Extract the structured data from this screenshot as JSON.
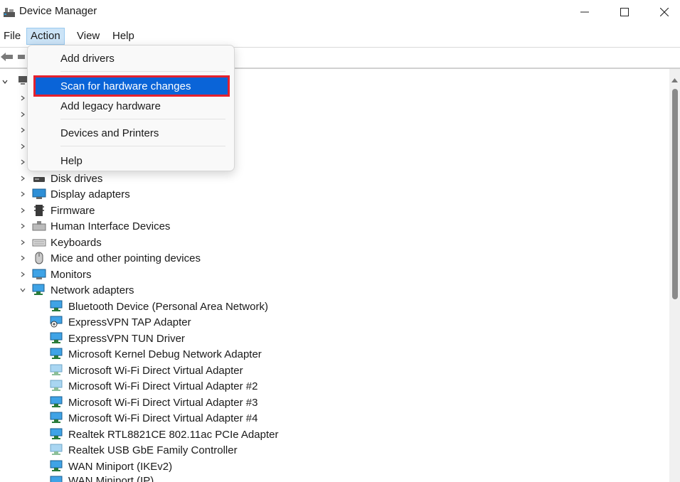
{
  "window": {
    "title": "Device Manager",
    "controls": {
      "minimize": "minimize",
      "maximize": "maximize",
      "close": "close"
    }
  },
  "menubar": {
    "items": [
      {
        "label": "File"
      },
      {
        "label": "Action",
        "active": true
      },
      {
        "label": "View"
      },
      {
        "label": "Help"
      }
    ]
  },
  "action_menu": {
    "items": [
      {
        "label": "Add drivers"
      },
      {
        "label": "Scan for hardware changes",
        "highlighted": true
      },
      {
        "label": "Add legacy hardware"
      },
      {
        "label": "Devices and Printers"
      },
      {
        "label": "Help"
      }
    ]
  },
  "tree": {
    "categories": [
      {
        "label": "Disk drives",
        "icon": "disk-drive-icon",
        "expanded": false
      },
      {
        "label": "Display adapters",
        "icon": "display-adapter-icon",
        "expanded": false
      },
      {
        "label": "Firmware",
        "icon": "firmware-icon",
        "expanded": false
      },
      {
        "label": "Human Interface Devices",
        "icon": "hid-icon",
        "expanded": false
      },
      {
        "label": "Keyboards",
        "icon": "keyboard-icon",
        "expanded": false
      },
      {
        "label": "Mice and other pointing devices",
        "icon": "mouse-icon",
        "expanded": false
      },
      {
        "label": "Monitors",
        "icon": "monitor-icon",
        "expanded": false
      },
      {
        "label": "Network adapters",
        "icon": "network-adapter-icon",
        "expanded": true
      }
    ],
    "network_adapters": [
      {
        "label": "Bluetooth Device (Personal Area Network)",
        "icon": "network-adapter-icon"
      },
      {
        "label": "ExpressVPN TAP Adapter",
        "icon": "network-adapter-icon"
      },
      {
        "label": "ExpressVPN TUN Driver",
        "icon": "network-adapter-icon"
      },
      {
        "label": "Microsoft Kernel Debug Network Adapter",
        "icon": "network-adapter-icon"
      },
      {
        "label": "Microsoft Wi-Fi Direct Virtual Adapter",
        "icon": "network-adapter-icon"
      },
      {
        "label": "Microsoft Wi-Fi Direct Virtual Adapter #2",
        "icon": "network-adapter-icon"
      },
      {
        "label": "Microsoft Wi-Fi Direct Virtual Adapter #3",
        "icon": "network-adapter-icon"
      },
      {
        "label": "Microsoft Wi-Fi Direct Virtual Adapter #4",
        "icon": "network-adapter-icon"
      },
      {
        "label": "Realtek RTL8821CE 802.11ac PCIe Adapter",
        "icon": "network-adapter-icon"
      },
      {
        "label": "Realtek USB GbE Family Controller",
        "icon": "network-adapter-icon"
      },
      {
        "label": "WAN Miniport (IKEv2)",
        "icon": "network-adapter-icon"
      },
      {
        "label": "WAN Miniport (IP)",
        "icon": "network-adapter-icon"
      }
    ]
  },
  "colors": {
    "highlight": "#0a64d8",
    "highlight_border": "#e4212e",
    "menu_active": "#cce4f7"
  }
}
